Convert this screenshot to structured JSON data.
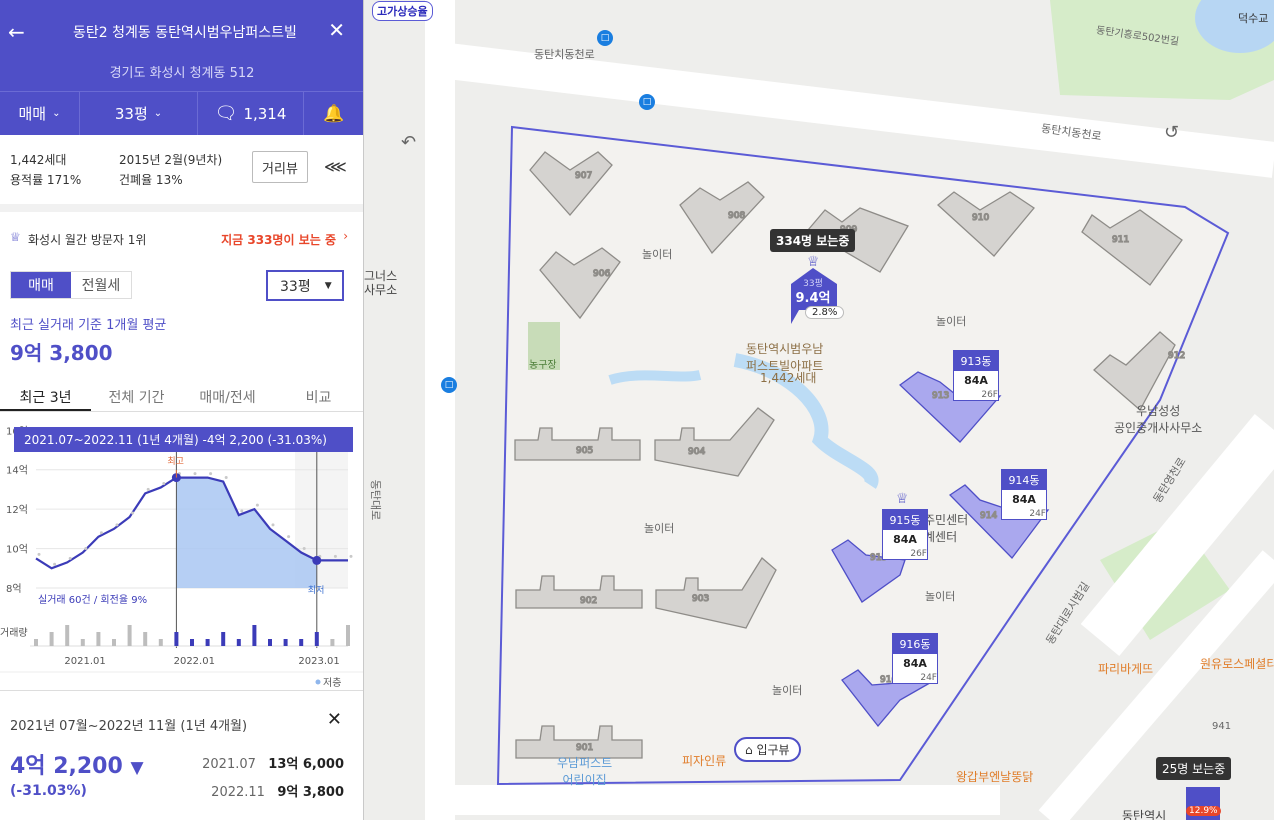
{
  "header": {
    "title": "동탄2 청계동 동탄역시범우남퍼스트빌",
    "address": "경기도 화성시 청계동 512",
    "trade_select": "매매",
    "area_select": "33평",
    "comments": "1,314"
  },
  "info": {
    "households": "1,442세대",
    "built": "2015년 2월(9년차)",
    "far": "용적률 171%",
    "bcr": "건폐율 13%",
    "street_view": "거리뷰"
  },
  "rank": {
    "label": "화성시 월간 방문자 1위",
    "watching": "지금 333명이 보는 중"
  },
  "tabs1": [
    "매매",
    "전월세"
  ],
  "pyeong": "33평",
  "avg": {
    "label": "최근 실거래 기준 1개월 평균",
    "price": "9억 3,800"
  },
  "period_tabs": [
    "최근 3년",
    "전체 기간",
    "매매/전세",
    "비교"
  ],
  "chart_data": {
    "type": "line",
    "x": [
      "2020.02",
      "2020.04",
      "2020.06",
      "2020.08",
      "2020.10",
      "2020.12",
      "2021.02",
      "2021.04",
      "2021.06",
      "2021.07",
      "2021.09",
      "2021.11",
      "2022.01",
      "2022.02",
      "2022.04",
      "2022.06",
      "2022.08",
      "2022.10",
      "2022.11",
      "2023.01",
      "2023.02"
    ],
    "series": [
      {
        "name": "",
        "values": [
          9.5,
          9.0,
          9.3,
          9.8,
          10.6,
          11.0,
          11.6,
          12.8,
          13.1,
          13.6,
          13.6,
          13.6,
          13.4,
          11.7,
          12.0,
          11.0,
          10.4,
          9.8,
          9.4,
          9.4,
          9.4
        ]
      }
    ],
    "ylim": [
      8,
      15
    ],
    "yticks": [
      "8억",
      "10억",
      "12억",
      "14억",
      "16억"
    ],
    "xticks": [
      "2021.01",
      "2022.01",
      "2023.01"
    ],
    "tooltip": "2021.07~2022.11 (1년 4개월)  -4억 2,200 (-31.03%)",
    "max_label": "최고",
    "min_label": "최저",
    "count_label": "실거래 60건 / 회전율 9%",
    "volume_label": "거래량",
    "volume": [
      1,
      2,
      3,
      1,
      2,
      1,
      3,
      2,
      1,
      2,
      1,
      1,
      2,
      1,
      3,
      1,
      1,
      1,
      2,
      1,
      3
    ],
    "legend": "저층"
  },
  "summary": {
    "period": "2021년 07월~2022년 11월 (1년 4개월)",
    "change": "4억 2,200",
    "pct": "(-31.03%)",
    "from_date": "2021.07",
    "from_price": "13억 6,000",
    "to_date": "2022.11",
    "to_price": "9억 3,800"
  },
  "map": {
    "watch_badge": "334명 보는중",
    "top_pyeong": "33평",
    "top_price": "9.4억",
    "top_pct": "2.8%",
    "complex_name": "동탄역시범우남\n퍼스트빌아파트",
    "complex_hh": "1,442세대",
    "dongs": [
      {
        "name": "913동",
        "type": "84A",
        "floor": "26F"
      },
      {
        "name": "914동",
        "type": "84A",
        "floor": "24F"
      },
      {
        "name": "915동",
        "type": "84A",
        "floor": "26F"
      },
      {
        "name": "916동",
        "type": "84A",
        "floor": "24F"
      }
    ],
    "labels": {
      "play1": "놀이터",
      "play2": "놀이터",
      "play3": "놀이터",
      "play4": "놀이터",
      "play5": "놀이터",
      "court": "농구장",
      "road1": "동탄치동천로",
      "road2": "동탄치동천로",
      "road3": "동탄기흥로502번길",
      "road4": "동탄대로",
      "road5": "동탄대로시범길",
      "road6": "동탄영천로",
      "office": "우남성성\n공인중개사사무소",
      "center": "주민센터\n계센터",
      "nursery": "우남퍼스트\n어린이집",
      "bakery": "파리바게뜨",
      "wonyu": "원유로스페셜티",
      "gopchang": "왕갑부엔날뚱닭",
      "pizza": "피자인류",
      "entrance": "입구뷰",
      "viewers2": "25명 보는중",
      "pct2": "12.9%",
      "dongtan": "동탄역시",
      "left1": "그너스",
      "left2": "사무소",
      "top1": "고가상승율",
      "top2": "덕수교",
      "bldg941": "941"
    },
    "bldg_nums": [
      "907",
      "908",
      "909",
      "910",
      "911",
      "906",
      "912",
      "913",
      "905",
      "904",
      "914",
      "915",
      "902",
      "903",
      "916",
      "901"
    ]
  }
}
